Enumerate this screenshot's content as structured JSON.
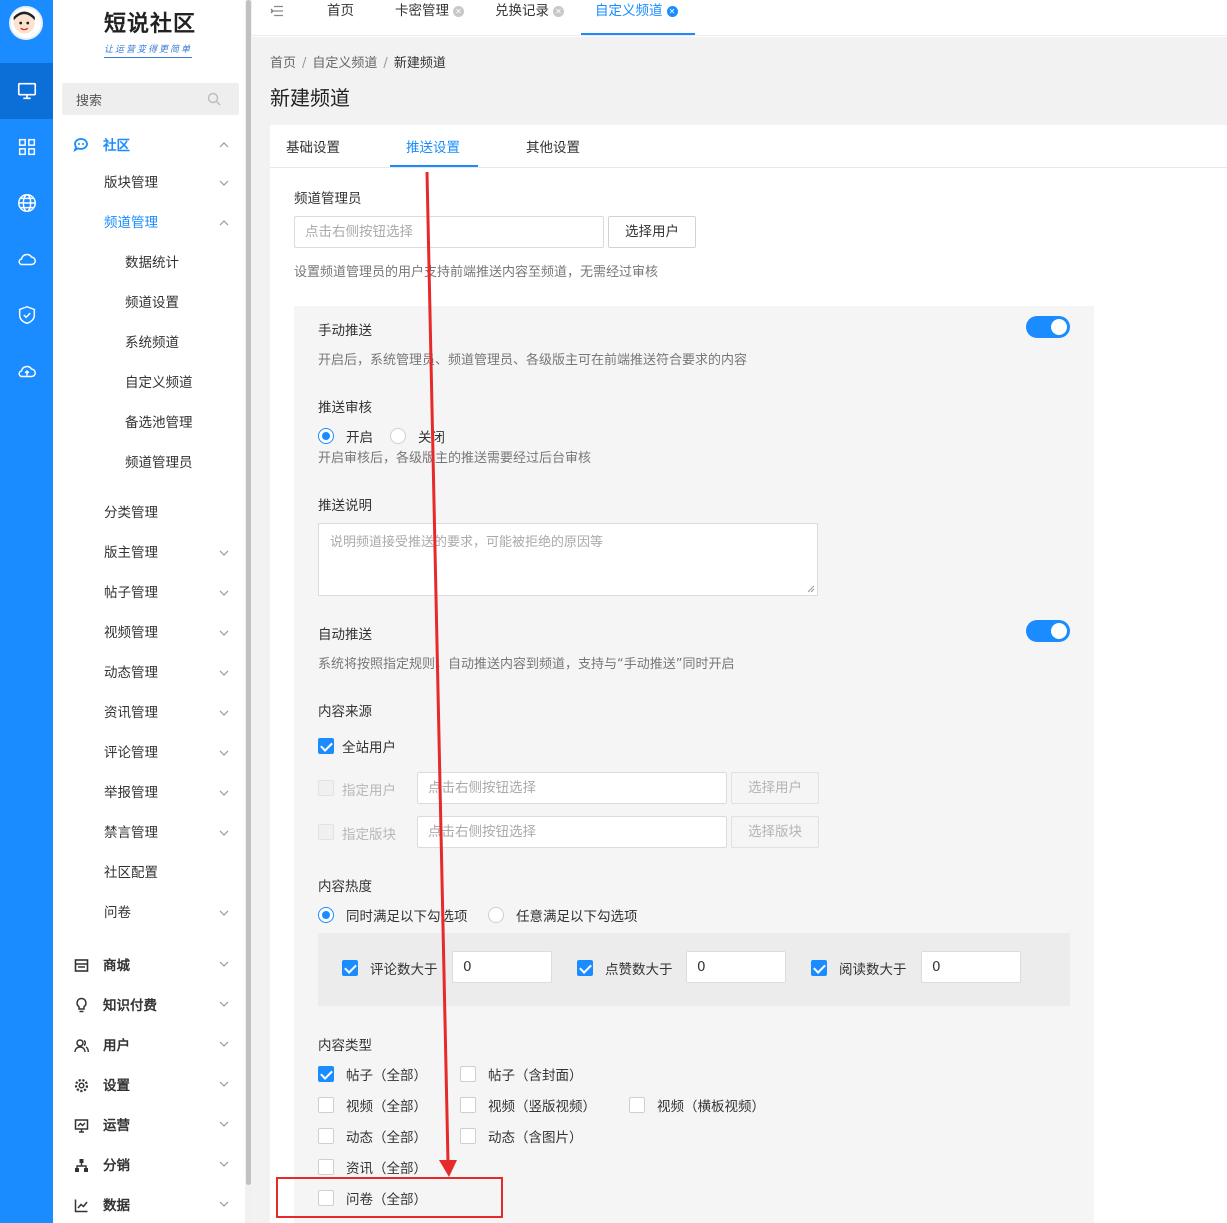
{
  "sidebar": {
    "logo_title": "短说社区",
    "logo_subtitle": "让运营变得更简单",
    "search_placeholder": "搜索",
    "rail_icons": [
      "monitor-icon",
      "grid-icon",
      "globe-icon",
      "cloud-icon",
      "shield-icon",
      "cloud-upload-icon"
    ],
    "menu": {
      "community": "社区",
      "block_mgmt": "版块管理",
      "channel_mgmt": "频道管理",
      "channel_children": [
        "数据统计",
        "频道设置",
        "系统频道",
        "自定义频道",
        "备选池管理",
        "频道管理员"
      ],
      "community_children": [
        "分类管理",
        "版主管理",
        "帖子管理",
        "视频管理",
        "动态管理",
        "资讯管理",
        "评论管理",
        "举报管理",
        "禁言管理",
        "社区配置",
        "问卷"
      ],
      "top_items": [
        "商城",
        "知识付费",
        "用户",
        "设置",
        "运营",
        "分销",
        "数据"
      ]
    }
  },
  "tabs": {
    "items": [
      {
        "label": "首页",
        "closable": false
      },
      {
        "label": "卡密管理",
        "closable": true
      },
      {
        "label": "兑换记录",
        "closable": true
      },
      {
        "label": "自定义频道",
        "closable": true,
        "active": true
      }
    ]
  },
  "breadcrumb": [
    "首页",
    "自定义频道",
    "新建频道"
  ],
  "page_title": "新建频道",
  "setting_tabs": [
    "基础设置",
    "推送设置",
    "其他设置"
  ],
  "form": {
    "admin_label": "频道管理员",
    "admin_placeholder": "点击右侧按钮选择",
    "select_user_btn": "选择用户",
    "admin_hint": "设置频道管理员的用户支持前端推送内容至频道，无需经过审核",
    "manual_push_label": "手动推送",
    "manual_push_on": true,
    "manual_push_hint": "开启后，系统管理员、频道管理员、各级版主可在前端推送符合要求的内容",
    "push_review_label": "推送审核",
    "review_on": "开启",
    "review_off": "关闭",
    "review_hint": "开启审核后，各级版主的推送需要经过后台审核",
    "push_desc_label": "推送说明",
    "push_desc_placeholder": "说明频道接受推送的要求，可能被拒绝的原因等",
    "auto_push_label": "自动推送",
    "auto_push_on": true,
    "auto_push_hint": "系统将按照指定规则，自动推送内容到频道，支持与“手动推送”同时开启",
    "source_label": "内容来源",
    "all_users": "全站用户",
    "specified_user": "指定用户",
    "specified_block": "指定版块",
    "picker_placeholder": "点击右侧按钮选择",
    "select_block_btn": "选择版块",
    "heat_label": "内容热度",
    "heat_all": "同时满足以下勾选项",
    "heat_any": "任意满足以下勾选项",
    "comments_gt": "评论数大于",
    "likes_gt": "点赞数大于",
    "reads_gt": "阅读数大于",
    "comments_value": "0",
    "likes_value": "0",
    "reads_value": "0",
    "type_label": "内容类型",
    "types": [
      "帖子（全部）",
      "帖子（含封面）",
      "视频（全部）",
      "视频（竖版视频）",
      "视频（横板视频）",
      "动态（全部）",
      "动态（含图片）",
      "资讯（全部）",
      "问卷（全部）"
    ]
  },
  "colors": {
    "primary": "#1a8cff",
    "rail_bg": "#1a8cff",
    "annotation_red": "#e62a2a"
  }
}
